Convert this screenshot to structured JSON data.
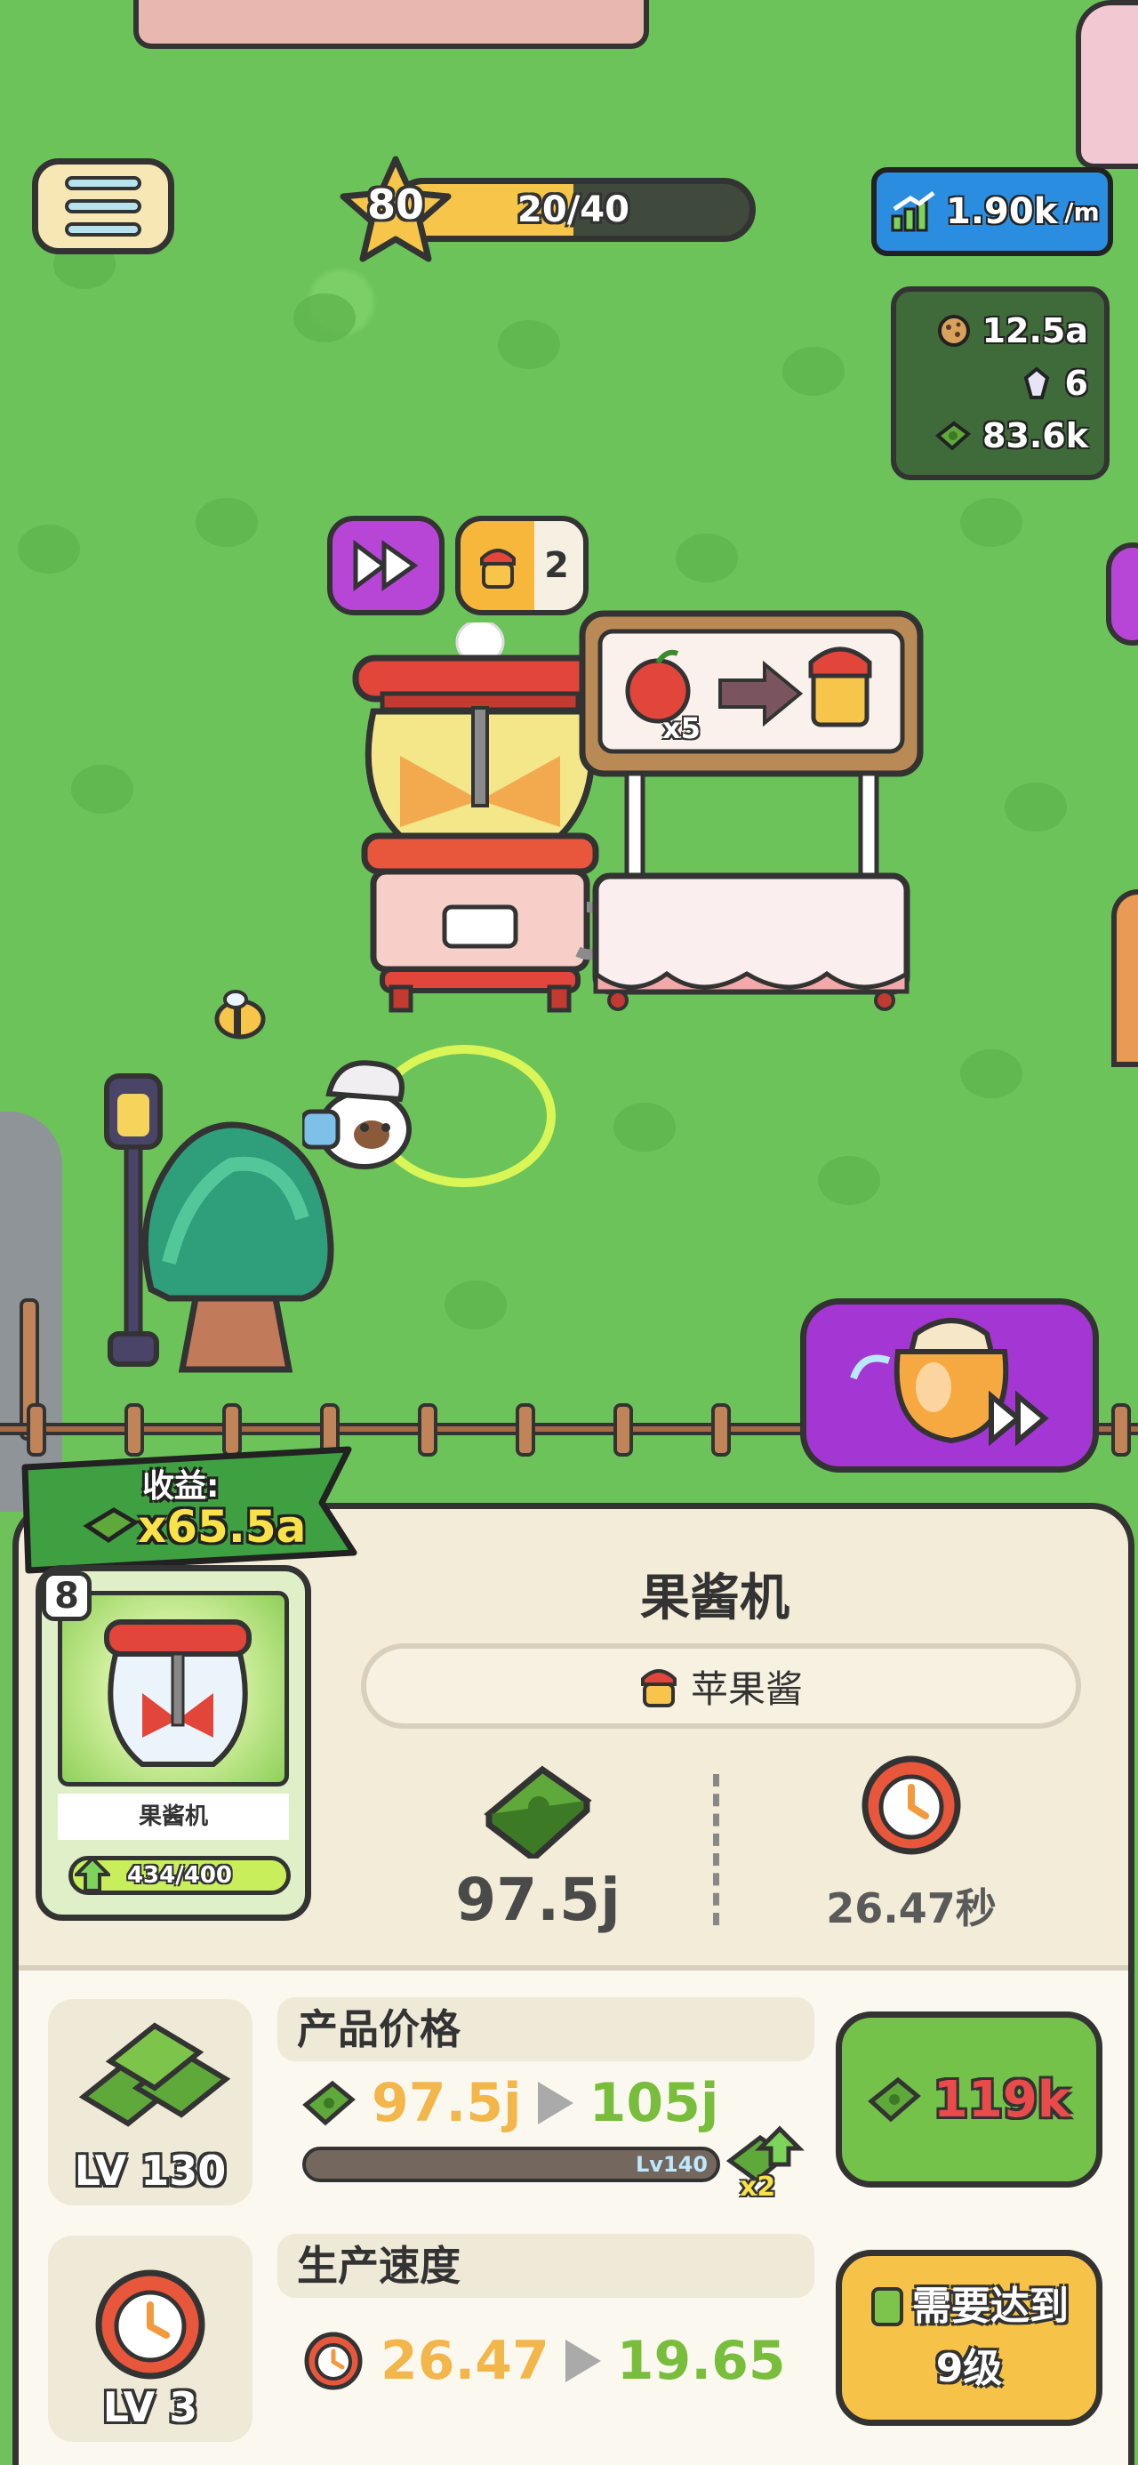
{
  "hud": {
    "player_level": "80",
    "xp_text": "20/40",
    "xp_progress": 0.5,
    "income_rate": "1.90k",
    "income_rate_unit": "/m",
    "resources": {
      "cookies": "12.5a",
      "gems": "6",
      "cash": "83.6k"
    }
  },
  "world": {
    "jam_count": "2",
    "recipe_multiplier": "x5"
  },
  "panel": {
    "earnings_label": "收益:",
    "earnings_value": "x65.5a",
    "card": {
      "level": "8",
      "name": "果酱机",
      "progress_text": "434/400",
      "progress": 1.0
    },
    "machine_name": "果酱机",
    "product_name": "苹果酱",
    "profit": "97.5j",
    "time": "26.47秒"
  },
  "upgrades": {
    "price": {
      "level": "LV 130",
      "title": "产品价格",
      "old_value": "97.5j",
      "new_value": "105j",
      "milestone_label": "Lv140",
      "milestone_bonus": "x2",
      "cost": "119k"
    },
    "speed": {
      "level": "LV 3",
      "title": "生产速度",
      "old_value": "26.47",
      "new_value": "19.65",
      "requirement_line1": "需要达到",
      "requirement_line2": "9级"
    }
  },
  "colors": {
    "grass": "#6cc35a",
    "panel": "#f3ecd9",
    "accent_green": "#74c24a",
    "accent_yellow": "#f6c247",
    "accent_purple": "#a437d3",
    "accent_blue": "#2b8de0"
  }
}
